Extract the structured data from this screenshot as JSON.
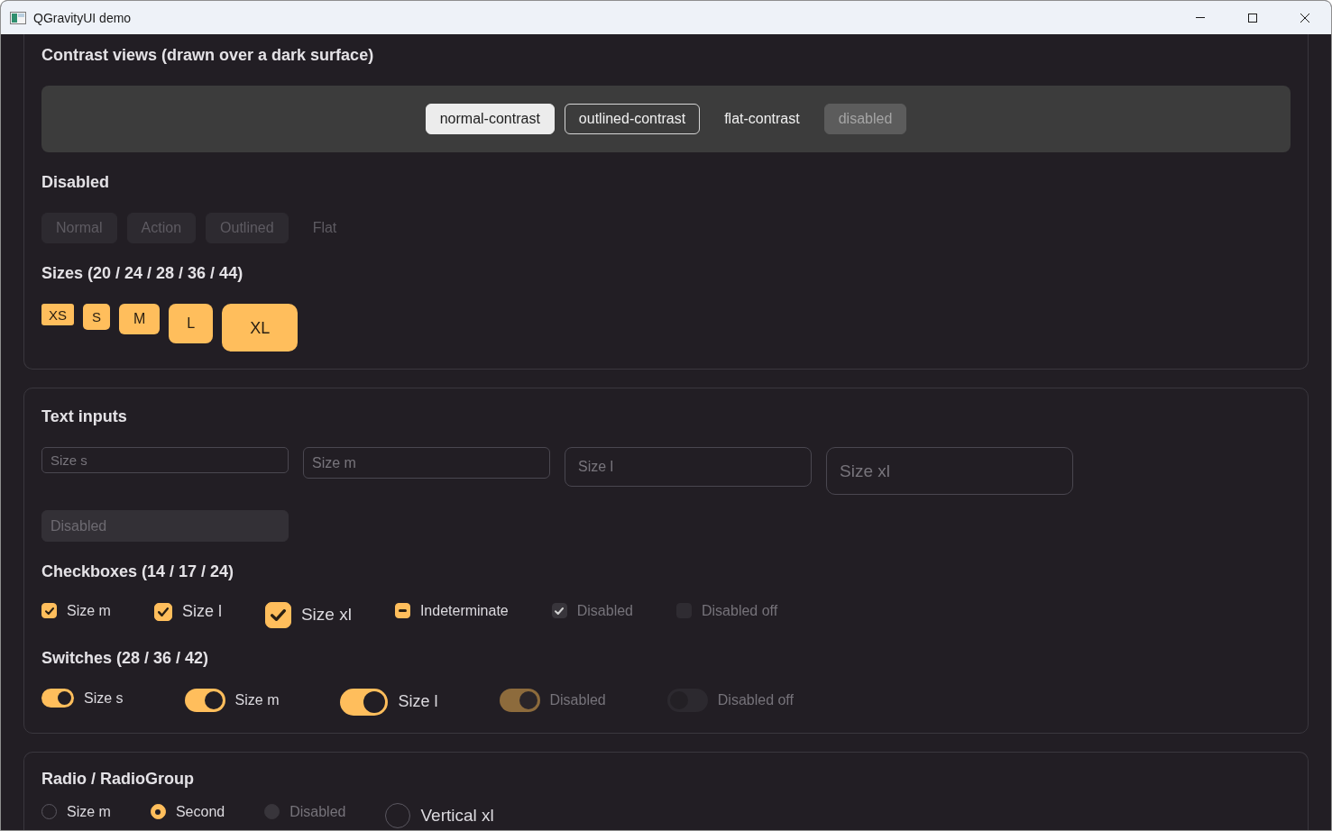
{
  "window": {
    "title": "QGravityUI demo"
  },
  "cards": [
    {
      "sections": [
        {
          "kind": "contrast",
          "heading": "Contrast views (drawn over a dark surface)",
          "items": [
            {
              "label": "normal-contrast",
              "kind": "filled",
              "disabled": false
            },
            {
              "label": "outlined-contrast",
              "kind": "outlined",
              "disabled": false
            },
            {
              "label": "flat-contrast",
              "kind": "flat",
              "disabled": false
            },
            {
              "label": "disabled",
              "kind": "filled",
              "disabled": true
            }
          ]
        },
        {
          "kind": "buttons",
          "heading": "Disabled",
          "items": [
            {
              "label": "Normal",
              "kind": "filled",
              "disabled": true
            },
            {
              "label": "Action",
              "kind": "filled",
              "disabled": true
            },
            {
              "label": "Outlined",
              "kind": "filled",
              "disabled": true
            },
            {
              "label": "Flat",
              "kind": "flat",
              "disabled": true
            }
          ]
        },
        {
          "kind": "sizes",
          "heading": "Sizes (20 / 24 / 28 / 36 / 44)",
          "items": [
            {
              "label": "XS",
              "kind": "xs",
              "disabled": false
            },
            {
              "label": "S",
              "kind": "s",
              "disabled": false
            },
            {
              "label": "M",
              "kind": "m",
              "disabled": false
            },
            {
              "label": "L",
              "kind": "l",
              "disabled": false
            },
            {
              "label": "XL",
              "kind": "xl",
              "disabled": false
            }
          ]
        }
      ]
    },
    {
      "sections": [
        {
          "kind": "inputs",
          "heading": "Text inputs",
          "items": [
            {
              "placeholder": "Size s",
              "kind": "s",
              "disabled": false
            },
            {
              "placeholder": "Size m",
              "kind": "m",
              "disabled": false
            },
            {
              "placeholder": "Size l",
              "kind": "l",
              "disabled": false
            },
            {
              "placeholder": "Size xl",
              "kind": "xl",
              "disabled": false
            },
            {
              "placeholder": "Disabled",
              "kind": "m",
              "disabled": true
            }
          ]
        },
        {
          "kind": "checkboxes",
          "heading": "Checkboxes (14 / 17 / 24)",
          "items": [
            {
              "label": "Size m",
              "kind": "m",
              "checked": true,
              "indeterminate": false,
              "disabled": false
            },
            {
              "label": "Size l",
              "kind": "l",
              "checked": true,
              "indeterminate": false,
              "disabled": false
            },
            {
              "label": "Size xl",
              "kind": "xl",
              "checked": true,
              "indeterminate": false,
              "disabled": false
            },
            {
              "label": "Indeterminate",
              "kind": "m",
              "checked": true,
              "indeterminate": true,
              "disabled": false
            },
            {
              "label": "Disabled",
              "kind": "m",
              "checked": true,
              "indeterminate": false,
              "disabled": true
            },
            {
              "label": "Disabled off",
              "kind": "m",
              "checked": false,
              "indeterminate": false,
              "disabled": true
            }
          ]
        },
        {
          "kind": "switches",
          "heading": "Switches (28 / 36 / 42)",
          "items": [
            {
              "label": "Size s",
              "kind": "s",
              "on": true,
              "disabled": false
            },
            {
              "label": "Size m",
              "kind": "m",
              "on": true,
              "disabled": false
            },
            {
              "label": "Size l",
              "kind": "l",
              "on": true,
              "disabled": false
            },
            {
              "label": "Disabled",
              "kind": "m",
              "on": true,
              "disabled": true
            },
            {
              "label": "Disabled off",
              "kind": "m",
              "on": false,
              "disabled": true
            }
          ]
        }
      ]
    },
    {
      "sections": [
        {
          "kind": "radios",
          "heading": "Radio / RadioGroup",
          "items": [
            {
              "label": "Size m",
              "kind": "m",
              "selected": false,
              "disabled": false
            },
            {
              "label": "Second",
              "kind": "m",
              "selected": true,
              "disabled": false
            },
            {
              "label": "Disabled",
              "kind": "m",
              "selected": false,
              "disabled": true
            },
            {
              "label": "Vertical xl",
              "kind": "xl",
              "selected": false,
              "disabled": false
            }
          ]
        }
      ]
    }
  ]
}
